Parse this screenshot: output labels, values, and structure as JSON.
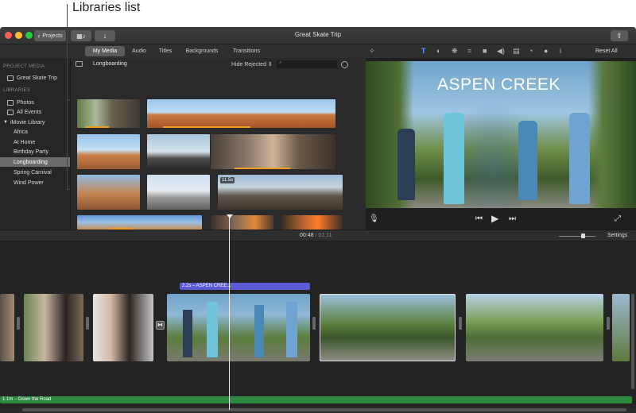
{
  "callout": {
    "label": "Libraries list"
  },
  "window": {
    "title": "Great Skate Trip",
    "projects_label": "Projects",
    "media_icon": "film-music-icon",
    "import_icon": "down-arrow-icon",
    "share_icon": "share-icon"
  },
  "tabs": [
    {
      "label": "My Media",
      "active": true
    },
    {
      "label": "Audio",
      "active": false
    },
    {
      "label": "Titles",
      "active": false
    },
    {
      "label": "Backgrounds",
      "active": false
    },
    {
      "label": "Transitions",
      "active": false
    }
  ],
  "sidebar": {
    "project_media_heading": "PROJECT MEDIA",
    "project_item": "Great Skate Trip",
    "libraries_heading": "LIBRARIES",
    "items": [
      {
        "label": "Photos",
        "selected": false
      },
      {
        "label": "All Events",
        "selected": false
      },
      {
        "label": "iMovie Library",
        "selected": false
      },
      {
        "label": "Africa",
        "selected": false
      },
      {
        "label": "At Home",
        "selected": false
      },
      {
        "label": "Birthday Party",
        "selected": false
      },
      {
        "label": "Longboarding",
        "selected": true
      },
      {
        "label": "Spring Carnival",
        "selected": false
      },
      {
        "label": "Wind Power",
        "selected": false
      }
    ]
  },
  "browser": {
    "event_title": "Longboarding",
    "hide_rejected": "Hide Rejected",
    "search_placeholder": "",
    "badge": "11.5s"
  },
  "viewer": {
    "reset_label": "Reset All",
    "title_overlay": "ASPEN CREEK",
    "tools": [
      "T",
      "◐",
      "❋",
      "⌗",
      "■",
      "◀)",
      "▤",
      "◔",
      "●",
      "i"
    ]
  },
  "timecode": {
    "current": "00:48",
    "separator": "/",
    "total": "01:11"
  },
  "settings_label": "Settings",
  "timeline": {
    "title_clip": "2.2s – ASPEN CREE...",
    "audio_clip": "1.1m – Down the Road"
  },
  "colors": {
    "accent_blue": "#4aa3ff",
    "title_clip_purple": "#5c5bd6",
    "audio_green": "#2d8a3e",
    "analysis_orange": "#f29c1f"
  }
}
